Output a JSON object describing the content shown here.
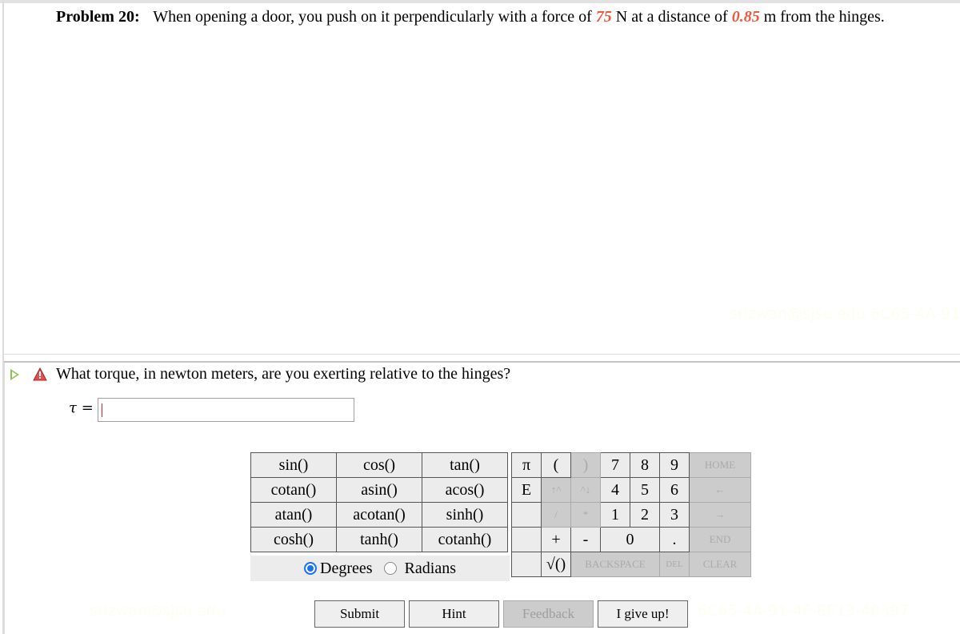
{
  "problem": {
    "label": "Problem 20:",
    "text_before_force": "When opening a door, you push on it perpendicularly with a force of",
    "force_value": "75",
    "text_between": "N at a distance of",
    "distance_value": "0.85",
    "text_after": "m from the hinges.",
    "variable_color": "#f05a3c"
  },
  "part": {
    "question": "What torque, in newton meters, are you exerting relative to the hinges?",
    "answer_symbol": "τ",
    "answer_equals": "=",
    "answer_value": ""
  },
  "functions": [
    [
      "sin()",
      "cos()",
      "tan()"
    ],
    [
      "cotan()",
      "asin()",
      "acos()"
    ],
    [
      "atan()",
      "acotan()",
      "sinh()"
    ],
    [
      "cosh()",
      "tanh()",
      "cotanh()"
    ]
  ],
  "angle_mode": {
    "options": [
      "Degrees",
      "Radians"
    ],
    "selected": "Degrees"
  },
  "keypad": {
    "row1": [
      "π",
      "(",
      ")",
      "7",
      "8",
      "9",
      "HOME"
    ],
    "row2": [
      "E",
      "↑^",
      "^↓",
      "4",
      "5",
      "6",
      "←"
    ],
    "row3": [
      "",
      "/",
      "*",
      "1",
      "2",
      "3",
      "→"
    ],
    "row4": [
      "",
      "+",
      "-",
      "0",
      ".",
      "END"
    ],
    "row5": [
      "",
      "√()",
      "BACKSPACE",
      "DEL",
      "CLEAR"
    ]
  },
  "buttons": {
    "submit": "Submit",
    "hint": "Hint",
    "feedback": "Feedback",
    "give_up": "I give up!"
  },
  "watermarks": {
    "email": "srizwan@sjsu.edu",
    "code": "6C65-4A-91-4F-8E13-40397"
  }
}
